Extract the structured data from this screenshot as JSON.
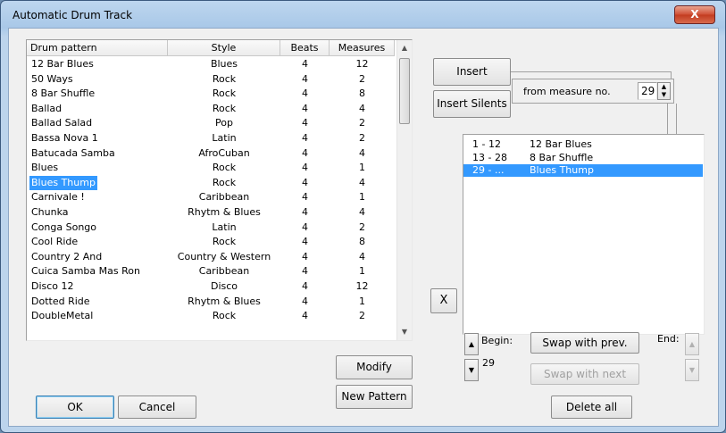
{
  "window": {
    "title": "Automatic Drum Track",
    "close_label": "X"
  },
  "pattern_list": {
    "headers": {
      "name": "Drum pattern",
      "style": "Style",
      "beats": "Beats",
      "measures": "Measures"
    },
    "rows": [
      {
        "name": "12 Bar Blues",
        "style": "Blues",
        "beats": "4",
        "measures": "12"
      },
      {
        "name": "50 Ways",
        "style": "Rock",
        "beats": "4",
        "measures": "2"
      },
      {
        "name": "8 Bar Shuffle",
        "style": "Rock",
        "beats": "4",
        "measures": "8"
      },
      {
        "name": "Ballad",
        "style": "Rock",
        "beats": "4",
        "measures": "4"
      },
      {
        "name": "Ballad Salad",
        "style": "Pop",
        "beats": "4",
        "measures": "2"
      },
      {
        "name": "Bassa Nova 1",
        "style": "Latin",
        "beats": "4",
        "measures": "2"
      },
      {
        "name": "Batucada Samba",
        "style": "AfroCuban",
        "beats": "4",
        "measures": "4"
      },
      {
        "name": "Blues",
        "style": "Rock",
        "beats": "4",
        "measures": "1"
      },
      {
        "name": "Blues Thump",
        "style": "Rock",
        "beats": "4",
        "measures": "4"
      },
      {
        "name": "Carnivale !",
        "style": "Caribbean",
        "beats": "4",
        "measures": "1"
      },
      {
        "name": "Chunka",
        "style": "Rhytm & Blues",
        "beats": "4",
        "measures": "4"
      },
      {
        "name": "Conga Songo",
        "style": "Latin",
        "beats": "4",
        "measures": "2"
      },
      {
        "name": "Cool Ride",
        "style": "Rock",
        "beats": "4",
        "measures": "8"
      },
      {
        "name": "Country 2 And",
        "style": "Country & Western",
        "beats": "4",
        "measures": "4"
      },
      {
        "name": "Cuica Samba Mas Ron",
        "style": "Caribbean",
        "beats": "4",
        "measures": "1"
      },
      {
        "name": "Disco 12",
        "style": "Disco",
        "beats": "4",
        "measures": "12"
      },
      {
        "name": "Dotted Ride",
        "style": "Rhytm & Blues",
        "beats": "4",
        "measures": "1"
      },
      {
        "name": "DoubleMetal",
        "style": "Rock",
        "beats": "4",
        "measures": "2"
      }
    ],
    "selected_index": 8
  },
  "buttons": {
    "insert": "Insert",
    "insert_silents": "Insert Silents",
    "modify": "Modify",
    "new_pattern": "New Pattern",
    "ok": "OK",
    "cancel": "Cancel",
    "x": "X",
    "swap_prev": "Swap with prev.",
    "swap_next": "Swap with next",
    "delete_all": "Delete all"
  },
  "from_measure": {
    "label": "from measure no.",
    "value": "29"
  },
  "track_list": {
    "rows": [
      {
        "range": "1 - 12",
        "name": "12 Bar Blues"
      },
      {
        "range": "13 - 28",
        "name": "8 Bar Shuffle"
      },
      {
        "range": "29 - ...",
        "name": "Blues Thump"
      }
    ],
    "selected_index": 2
  },
  "begin": {
    "label": "Begin:",
    "value": "29"
  },
  "end": {
    "label": "End:"
  }
}
